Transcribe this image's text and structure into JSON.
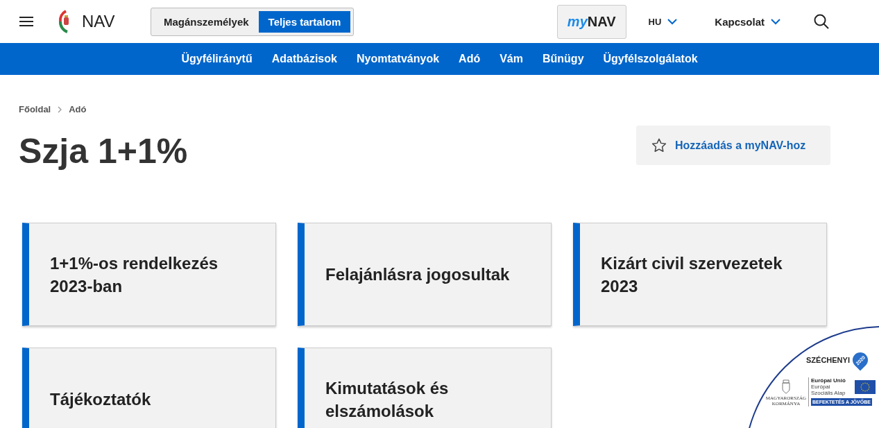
{
  "header": {
    "logo_text": "NAV",
    "audience_toggle": [
      {
        "label": "Magánszemélyek",
        "selected": false
      },
      {
        "label": "Teljes tartalom",
        "selected": true
      }
    ],
    "mynav": {
      "prefix": "my",
      "name": "NAV"
    },
    "language": "HU",
    "contact": "Kapcsolat"
  },
  "main_nav": [
    "Ügyféliránytű",
    "Adatbázisok",
    "Nyomtatványok",
    "Adó",
    "Vám",
    "Bűnügy",
    "Ügyfélszolgálatok"
  ],
  "breadcrumb": [
    "Főoldal",
    "Adó"
  ],
  "title": "Szja 1+1%",
  "favorite_button": "Hozzáadás a myNAV-hoz",
  "cards": [
    {
      "title": "1+1%-os rendelkezés 2023-ban"
    },
    {
      "title": "Felajánlásra jogosultak"
    },
    {
      "title": "Kizárt civil szervezetek 2023"
    },
    {
      "title": "Tájékoztatók"
    },
    {
      "title": "Kimutatások és elszámolások"
    }
  ],
  "funding_badge": {
    "program": "SZÉCHENYI",
    "year": "2020",
    "government": "MAGYARORSZÁG KORMÁNYA",
    "eu_title": "Európai Unió",
    "eu_fund": "Európai Szociális Alap",
    "slogan": "BEFEKTETÉS A JÖVŐBE"
  }
}
